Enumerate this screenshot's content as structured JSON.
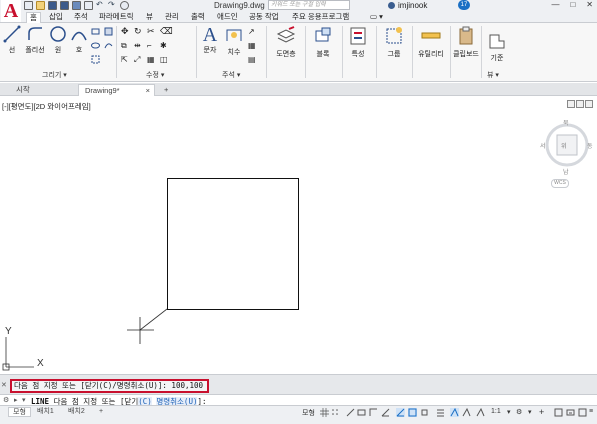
{
  "titlebar": {
    "app_logo": "A",
    "doc_title": "Drawing9.dwg",
    "search_placeholder": "키워드 또는 구절 입력",
    "user_name": "imjinook",
    "notification_count": "17",
    "win_minimize": "—",
    "win_maximize": "□",
    "win_close": "✕"
  },
  "menu": {
    "tabs": [
      "홈",
      "삽입",
      "주석",
      "파라메트릭",
      "뷰",
      "관리",
      "출력",
      "애드인",
      "공동 작업",
      "주요 응용프로그램"
    ],
    "active_tab": "홈"
  },
  "ribbon": {
    "draw": {
      "line": "선",
      "polyline": "폴리선",
      "circle": "원",
      "arc": "호",
      "panel": "그리기 ▾"
    },
    "modify": {
      "panel": "수정 ▾"
    },
    "annotation": {
      "text": "문자",
      "dimension": "치수",
      "panel": "주석 ▾"
    },
    "layers": {
      "label": "도면층"
    },
    "block": {
      "label": "블록"
    },
    "properties": {
      "label": "특성"
    },
    "groups": {
      "label": "그룹"
    },
    "utilities": {
      "label": "유틸리티"
    },
    "clipboard": {
      "label": "클립보드"
    },
    "view": {
      "base": "기준",
      "panel": "뷰 ▾"
    }
  },
  "file_tabs": {
    "start": "시작",
    "drawing": "Drawing9*",
    "close": "×",
    "add": "+"
  },
  "canvas": {
    "viewport_label": "[-][평면도][2D 와이어프레임]",
    "viewcube_north": "북",
    "viewcube_south": "남",
    "viewcube_east": "동",
    "viewcube_west": "서",
    "viewcube_top": "위",
    "wcs": "WCS",
    "ucs_y": "Y",
    "ucs_x": "X"
  },
  "command": {
    "history_line": "다음 점 지정 또는 [닫기(C)/명령취소(U)]: 100,100",
    "prompt_keyword": "LINE",
    "prompt_text_1": " 다음 점 지정 또는 [닫기",
    "prompt_opt_1": "(C)",
    "prompt_text_2": " ",
    "prompt_opt_2": "명령취소(U)",
    "prompt_text_3": "]:",
    "close_icon": "✕",
    "wrench_icon": "⚙"
  },
  "status": {
    "layout_tabs": [
      "모형",
      "배치1",
      "배치2"
    ],
    "active_layout": "모형",
    "add_layout": "+",
    "model_label": "모형",
    "scale": "1:1"
  },
  "colors": {
    "accent": "#c8102e",
    "highlight_box": "#c8102e",
    "status_active": "#1a6fc4"
  }
}
